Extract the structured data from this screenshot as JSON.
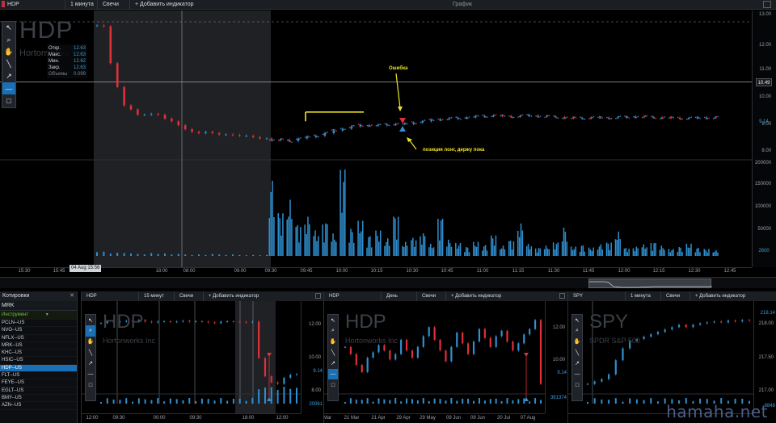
{
  "main": {
    "symbol": "HDP",
    "timeframe": "1 минута",
    "chart_type": "Свечи",
    "add_indicator": "+ Добавить индикатор",
    "window_title": "График",
    "watermark_symbol": "HDP",
    "watermark_company": "Hortonworks Inc",
    "ohlc": {
      "open_label": "Откр.",
      "open": "12.63",
      "high_label": "Макс.",
      "high": "12.63",
      "low_label": "Мин.",
      "low": "12.62",
      "close_label": "Закр.",
      "close": "12.63",
      "volume_label": "Объемы",
      "volume": "0.099"
    },
    "price_ticks": [
      "13.00",
      "12.00",
      "11.00",
      "10.00",
      "9.00",
      "8.00"
    ],
    "price_marker": "10.49",
    "last_price": "9.14",
    "volume_ticks": [
      "200000",
      "150000",
      "100000",
      "50000"
    ],
    "volume_last": "2600",
    "time_ticks": [
      "15:30",
      "15:45",
      "18:00",
      "08:00",
      "09:00",
      "09:30",
      "09:45",
      "10:00",
      "10:15",
      "10:30",
      "10:45",
      "11:00",
      "11:15",
      "11:30",
      "11:45",
      "12:00",
      "12:15",
      "12:30",
      "12:45"
    ],
    "cursor_time": "04 Aug 15:56",
    "annotation_error": "Ошибка",
    "annotation_position": "позиция лонг, держу пока",
    "colors": {
      "up": "#2f8fd0",
      "down": "#e0303a",
      "annotation": "#f0e61e",
      "highlight": "#1a6fb5"
    },
    "chart_data": {
      "type": "candlestick",
      "price_range": [
        7.6,
        13.2
      ],
      "volume_range": [
        0,
        200000
      ],
      "close_series": [
        12.63,
        12.6,
        11.2,
        10.3,
        9.6,
        9.45,
        9.25,
        9.25,
        9.28,
        9.25,
        9.1,
        9.0,
        8.85,
        8.7,
        8.6,
        8.55,
        8.6,
        8.55,
        8.5,
        8.5,
        8.48,
        8.45,
        8.45,
        8.4,
        8.35,
        8.35,
        8.3,
        8.3,
        8.25,
        8.35,
        8.4,
        8.45,
        8.55,
        8.65,
        8.72,
        8.8,
        8.85,
        8.85,
        8.85,
        8.88,
        8.9,
        8.9,
        8.95,
        9.0,
        9.05,
        9.08,
        9.1,
        9.12,
        9.15,
        9.18,
        9.2,
        9.22,
        9.2,
        9.18,
        9.2,
        9.22,
        9.2,
        9.18,
        9.16,
        9.14,
        9.12,
        9.12,
        9.14,
        9.14,
        9.13,
        9.15,
        9.16,
        9.18,
        9.17,
        9.15,
        9.14,
        9.13,
        9.12,
        9.12,
        9.13,
        9.14,
        9.14
      ],
      "volume_series": [
        8000,
        9000,
        5000,
        7000,
        6000,
        5000,
        4000,
        3000,
        6000,
        4000,
        5000,
        3000,
        4000,
        3000,
        2000,
        3000,
        2000,
        4000,
        3000,
        2000,
        3000,
        2000,
        1500,
        2000,
        1500,
        2000,
        165000,
        95000,
        120000,
        70000,
        85000,
        55000,
        75000,
        48000,
        190000,
        60000,
        75000,
        45000,
        55000,
        38000,
        90000,
        30000,
        40000,
        50000,
        26000,
        85000,
        35000,
        28000,
        20000,
        30000,
        24000,
        45000,
        22000,
        35000,
        70000,
        26000,
        18000,
        22000,
        30000,
        62000,
        20000,
        24000,
        18000,
        25000,
        30000,
        52000,
        18000,
        20000,
        25000,
        30000,
        22000,
        15000,
        20000,
        26000,
        18000,
        15000,
        12000
      ]
    }
  },
  "quotes": {
    "title": "Котировки",
    "search_value": "MRK",
    "column_header": "Инструмент",
    "items": [
      "PCLN--US",
      "NVO--US",
      "NFLX--US",
      "MRK--US",
      "KHC--US",
      "HSIC--US",
      "HDP--US",
      "FLT--US",
      "FEYE--US",
      "EGLT--US",
      "BMY--US",
      "AZN--US"
    ],
    "selected_index": 6
  },
  "chart2": {
    "symbol": "HDP",
    "timeframe": "15 минут",
    "chart_type": "Свечи",
    "add_indicator": "+ Добавить индикатор",
    "watermark_symbol": "HDP",
    "watermark_company": "Hortonworks Inc",
    "price_ticks": [
      "12.00",
      "10.00",
      "9.14",
      "8.00"
    ],
    "volume_last": "20061",
    "time_ticks": [
      "12:00",
      "09:30",
      "00:00",
      "09:30",
      "18:00",
      "12:00"
    ],
    "chart_data": {
      "type": "candlestick",
      "close_series": [
        12.5,
        12.6,
        12.55,
        12.6,
        12.65,
        12.6,
        12.7,
        12.6,
        12.55,
        12.6,
        12.62,
        12.58,
        12.6,
        12.65,
        12.6,
        12.62,
        12.6,
        12.55,
        12.5,
        12.6,
        12.62,
        12.6,
        12.58,
        12.55,
        12.6,
        10.2,
        9.0,
        8.6,
        8.5,
        8.9,
        9.1,
        9.14
      ]
    }
  },
  "chart3": {
    "symbol": "HDP",
    "timeframe": "День",
    "chart_type": "Свечи",
    "add_indicator": "+ Добавить индикатор",
    "watermark_symbol": "HDP",
    "watermark_company": "Hortonworks Inc",
    "price_ticks": [
      "12.00",
      "10.00",
      "9.14"
    ],
    "volume_last": "391374",
    "time_ticks": [
      "Mar",
      "21 Mar",
      "21 Apr",
      "29 Apr",
      "29 May",
      "09 Jun",
      "09 Jun",
      "20 Jul",
      "07 Aug"
    ],
    "chart_data": {
      "type": "candlestick",
      "close_series": [
        11.2,
        10.8,
        10.2,
        9.8,
        10.6,
        10.9,
        11.3,
        11.0,
        10.5,
        10.8,
        11.6,
        11.0,
        10.6,
        11.2,
        11.8,
        12.3,
        11.6,
        11.0,
        10.4,
        11.2,
        12.0,
        11.4,
        10.8,
        11.5,
        12.2,
        11.7,
        11.2,
        11.8,
        12.1,
        11.5,
        11.0,
        11.4,
        11.9,
        12.2,
        12.7,
        9.14
      ]
    }
  },
  "chart4": {
    "symbol": "SPY",
    "timeframe": "1 минута",
    "chart_type": "Свечи",
    "add_indicator": "+ Добавить индикатор",
    "watermark_symbol": "SPY",
    "watermark_company": "SPDR S&P 500",
    "price_ticks": [
      "218.14",
      "218.00",
      "217.50",
      "217.00"
    ],
    "volume_last": "8848",
    "chart_data": {
      "type": "candlestick",
      "close_series": [
        216.8,
        216.85,
        216.9,
        217.0,
        217.3,
        217.55,
        217.7,
        217.75,
        217.8,
        217.85,
        217.9,
        217.95,
        218.0,
        218.05,
        218.0,
        218.05,
        218.08,
        218.1,
        218.12,
        218.1,
        218.14,
        218.12,
        218.15,
        218.14
      ]
    }
  }
}
